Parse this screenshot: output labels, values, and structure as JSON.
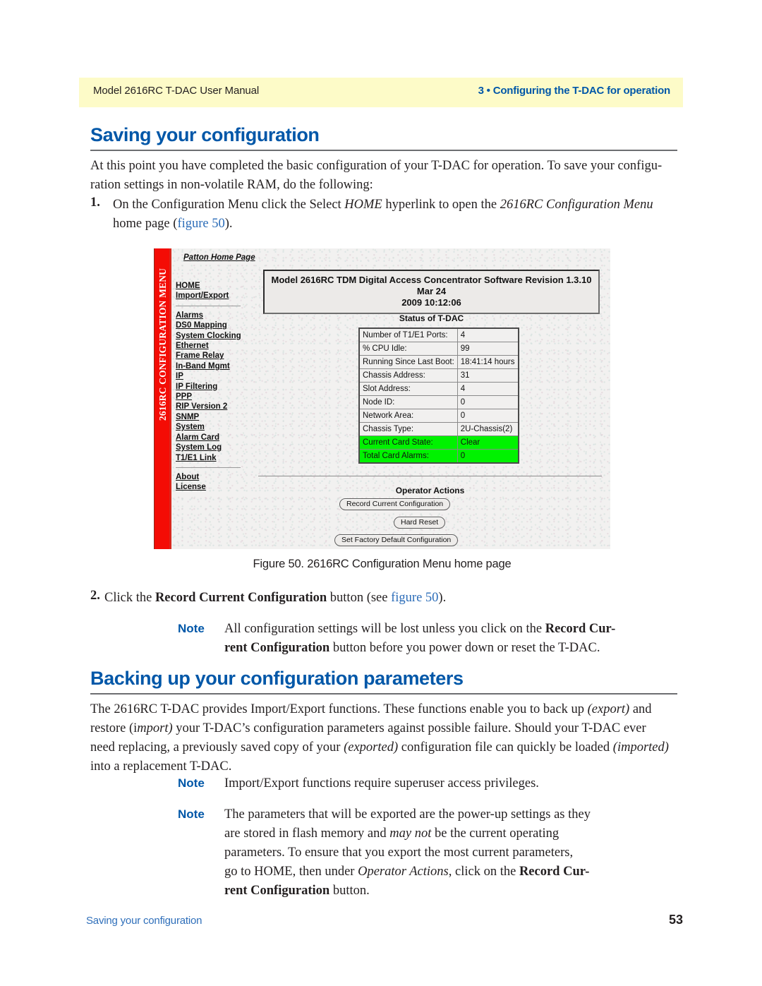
{
  "header": {
    "left": "Model 2616RC T-DAC User Manual",
    "right": "3 • Configuring the T-DAC for operation",
    "band_color": "#fdfbc8",
    "accent_color": "#0057a8"
  },
  "section1": {
    "heading": "Saving your configuration",
    "intro_line1": "At this point you have completed the basic configuration of your T-DAC for operation. To save your configu-",
    "intro_line2": "ration settings in non-volatile RAM, do the following:",
    "step1": {
      "number": "1.",
      "line1_a": "On the Configuration Menu click the Select ",
      "line1_italic1": "HOME",
      "line1_b": " hyperlink to open the ",
      "line1_italic2": "2616RC Configuration Menu",
      "line2_a": "home page (",
      "line2_link": "figure 50",
      "line2_b": ")."
    },
    "step2": {
      "number": "2.",
      "a": "Click the ",
      "bold": "Record Current Configuration",
      "b": " button (see ",
      "link": "figure 50",
      "c": ")."
    },
    "note1": {
      "label": "Note",
      "line1_a": "All configuration settings will be lost unless you click on the ",
      "line1_bold": "Record Cur-",
      "line2_bold": "rent Configuration",
      "line2_b": " button before you power down or reset the T-DAC."
    }
  },
  "figure": {
    "caption": "Figure 50. 2616RC Configuration Menu home page",
    "sidebar_vertical_label": "2616RC CONFIGURATION MENU",
    "sidebar_bar_color": "#f40c05",
    "patton_home_link": "Patton Home Page",
    "menu_group1": [
      "HOME",
      "Import/Export"
    ],
    "menu_group2": [
      "Alarms",
      "DS0 Mapping",
      "System Clocking",
      "Ethernet",
      "Frame Relay",
      "In-Band Mgmt",
      "IP",
      "IP Filtering",
      "PPP",
      "RIP Version 2",
      "SNMP",
      "System",
      "Alarm Card",
      "System Log",
      "T1/E1 Link"
    ],
    "menu_group3": [
      "About",
      "License"
    ],
    "title_line1": "Model 2616RC TDM Digital Access Concentrator Software Revision 1.3.10 Mar 24",
    "title_line2": "2009 10:12:06",
    "status_title": "Status of T-DAC",
    "status_highlight_color": "#00f200",
    "status_rows": [
      {
        "label": "Number of T1/E1 Ports:",
        "value": "4",
        "highlight": false
      },
      {
        "label": "% CPU Idle:",
        "value": "99",
        "highlight": false
      },
      {
        "label": "Running Since Last Boot:",
        "value": "18:41:14 hours",
        "highlight": false
      },
      {
        "label": "Chassis Address:",
        "value": "31",
        "highlight": false
      },
      {
        "label": "Slot Address:",
        "value": "4",
        "highlight": false
      },
      {
        "label": "Node ID:",
        "value": "0",
        "highlight": false
      },
      {
        "label": "Network Area:",
        "value": "0",
        "highlight": false
      },
      {
        "label": "Chassis Type:",
        "value": "2U-Chassis(2)",
        "highlight": false
      },
      {
        "label": "Current Card State:",
        "value": "Clear",
        "highlight": true
      },
      {
        "label": "Total Card Alarms:",
        "value": "0",
        "highlight": true
      }
    ],
    "operator_actions_title": "Operator Actions",
    "buttons": [
      "Record Current Configuration",
      "Hard Reset",
      "Set Factory Default Configuration"
    ]
  },
  "section2": {
    "heading": "Backing up your configuration parameters",
    "para_line1_a": "The 2616RC T-DAC provides Import/Export functions. These functions enable you to back up ",
    "para_line1_italic": "(export)",
    "para_line1_b": " and",
    "para_line2_a": "restore (i",
    "para_line2_italic": "mport)",
    "para_line2_b": " your T-DAC’s configuration parameters against possible failure. Should your T-DAC ever",
    "para_line3_a": "need replacing, a previously saved copy of your ",
    "para_line3_italic1": "(exported)",
    "para_line3_b": " configuration file can quickly be loaded ",
    "para_line3_italic2": "(imported)",
    "para_line4": "into a replacement T-DAC.",
    "note2": {
      "label": "Note",
      "text": "Import/Export functions require superuser access privileges."
    },
    "note3": {
      "label": "Note",
      "line1": "The parameters that will be exported are the power-up settings as they",
      "line2_a": "are stored in flash memory and ",
      "line2_italic": "may not",
      "line2_b": " be the current operating",
      "line3": "parameters. To ensure that you export the most current parameters,",
      "line4_a": "go to HOME, then under ",
      "line4_italic": "Operator Actions",
      "line4_b": ", click on the ",
      "line4_bold": "Record Cur-",
      "line5_bold": "rent Configuration",
      "line5_b": " button."
    }
  },
  "footer": {
    "left": "Saving your configuration",
    "page": "53"
  }
}
